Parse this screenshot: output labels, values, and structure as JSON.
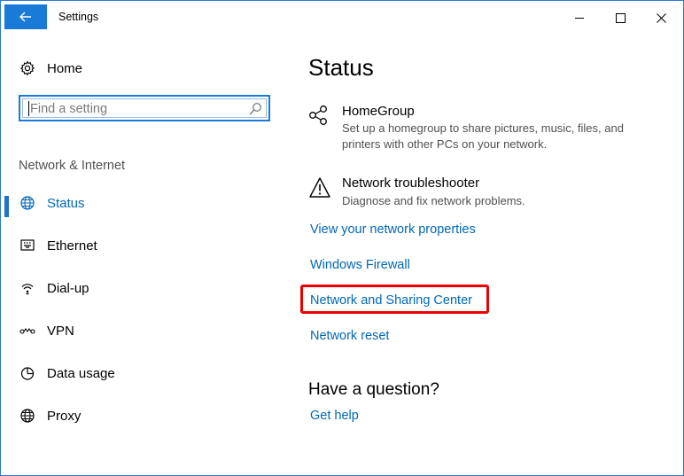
{
  "window": {
    "title": "Settings"
  },
  "sidebar": {
    "home_label": "Home",
    "search_placeholder": "Find a setting",
    "section_label": "Network & Internet",
    "items": [
      {
        "label": "Status",
        "icon": "globe-icon",
        "active": true
      },
      {
        "label": "Ethernet",
        "icon": "ethernet-icon"
      },
      {
        "label": "Dial-up",
        "icon": "dialup-icon"
      },
      {
        "label": "VPN",
        "icon": "vpn-icon"
      },
      {
        "label": "Data usage",
        "icon": "data-usage-icon"
      },
      {
        "label": "Proxy",
        "icon": "globe-icon"
      }
    ]
  },
  "main": {
    "title": "Status",
    "homegroup": {
      "title": "HomeGroup",
      "description": "Set up a homegroup to share pictures, music, files, and printers with other PCs on your network."
    },
    "troubleshooter": {
      "title": "Network troubleshooter",
      "description": "Diagnose and fix network problems."
    },
    "links": [
      "View your network properties",
      "Windows Firewall",
      "Network and Sharing Center",
      "Network reset"
    ],
    "question_heading": "Have a question?",
    "help_link": "Get help"
  },
  "colors": {
    "accent": "#0067b8",
    "title_back_button": "#1a7ad8",
    "highlight": "#ee0000"
  }
}
